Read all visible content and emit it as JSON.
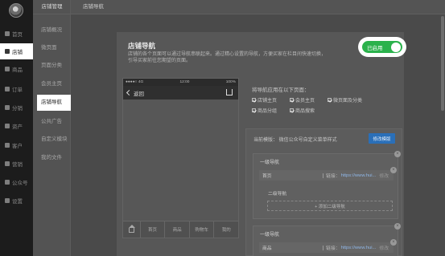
{
  "sidebar": {
    "items": [
      {
        "label": "首页",
        "icon": "home-icon"
      },
      {
        "label": "店铺",
        "icon": "shop-icon",
        "active": true
      },
      {
        "label": "商品",
        "icon": "goods-icon"
      },
      {
        "label": "订单",
        "icon": "order-icon"
      },
      {
        "label": "分销",
        "icon": "distribution-icon"
      },
      {
        "label": "资产",
        "icon": "asset-icon"
      },
      {
        "label": "客户",
        "icon": "customer-icon"
      },
      {
        "label": "营销",
        "icon": "marketing-icon"
      },
      {
        "label": "公众号",
        "icon": "official-account-icon"
      },
      {
        "label": "设置",
        "icon": "settings-icon"
      }
    ]
  },
  "sub_sidebar": {
    "title": "店铺管理",
    "items": [
      "店铺概况",
      "微页面",
      "页面分类",
      "会员主页",
      "店铺导航",
      "公共广告",
      "自定义模块",
      "我的文件"
    ],
    "active_index": 4
  },
  "topbar": {
    "title": "店铺导航"
  },
  "header": {
    "title": "店铺导航",
    "desc_line1": "店铺的各个页面可以通过导航串联起来。通过精心设置的导航，方便买家在栏目间快速切换，",
    "desc_line2": "引导买家前往您期望的页面。"
  },
  "toggle": {
    "label": "已启用",
    "on": true,
    "color": "#2bb24c"
  },
  "phone": {
    "status_left": "●●●●○ 4G",
    "status_time": "12:00",
    "status_right": "100%",
    "back_label": "返回",
    "tabs": [
      "首页",
      "商品",
      "购物车",
      "我的"
    ]
  },
  "apply": {
    "title": "将导航应用在以下页面：",
    "options": [
      "店铺主页",
      "会员主页",
      "微页面及分类",
      "商品分组",
      "商品搜索"
    ]
  },
  "template": {
    "label": "当前模版：  微信公众号自定义菜单样式",
    "change_button": "修改模版",
    "change_button_color": "#2a6fb8"
  },
  "nav_groups": [
    {
      "title": "一级导航",
      "row_name": "首页",
      "link_label": "链接：",
      "link_url": "https://www.hui...",
      "edit_label": "修改",
      "sub_title": "二级导航",
      "add_label": "+ 添加二级导航"
    },
    {
      "title": "一级导航",
      "row_name": "商品",
      "link_label": "链接：",
      "link_url": "https://www.hui...",
      "edit_label": "修改"
    }
  ]
}
